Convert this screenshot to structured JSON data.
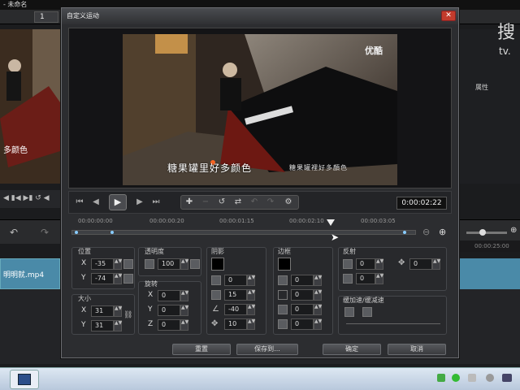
{
  "app": {
    "title": "- 未命名",
    "tab_number": "1",
    "track_clip_label": "明明就.mp4",
    "search_big": "搜",
    "search_sub": "tv.",
    "properties_label": "属性",
    "ruler_right": "00:00:25:00"
  },
  "dialog": {
    "title": "自定义运动",
    "close_label": "✕",
    "watermark": "优酷",
    "subtitle_main": "糖果罐里好多颜色",
    "subtitle_side": "糖果罐裡好多顏色",
    "timecode": "0:00:02:22",
    "ruler_ticks": [
      "00:00:00:00",
      "00:00:00:20",
      "00:00:01:15",
      "00:00:02:10",
      "00:00:03:05"
    ],
    "position": {
      "label": "位置",
      "x_label": "X",
      "x": "-35",
      "y_label": "Y",
      "y": "-74"
    },
    "size": {
      "label": "大小",
      "x_label": "X",
      "x": "31",
      "y_label": "Y",
      "y": "31"
    },
    "opacity": {
      "label": "透明度",
      "value": "100"
    },
    "rotation": {
      "label": "旋转",
      "x_label": "X",
      "x": "0",
      "y_label": "Y",
      "y": "0",
      "z_label": "Z",
      "z": "0"
    },
    "shadow": {
      "label": "阴影",
      "v1": "0",
      "v2": "15",
      "v3": "-40",
      "v4": "10"
    },
    "border": {
      "label": "边框",
      "v1": "0",
      "v2": "0",
      "v3": "0",
      "v4": "0"
    },
    "reflection": {
      "label": "反射",
      "v1": "0",
      "v2": "0",
      "v3": "0"
    },
    "easing": {
      "label": "缓加速/缓减速"
    },
    "buttons": {
      "reset": "重置",
      "save_as": "保存到...",
      "ok": "确定",
      "cancel": "取消"
    }
  }
}
